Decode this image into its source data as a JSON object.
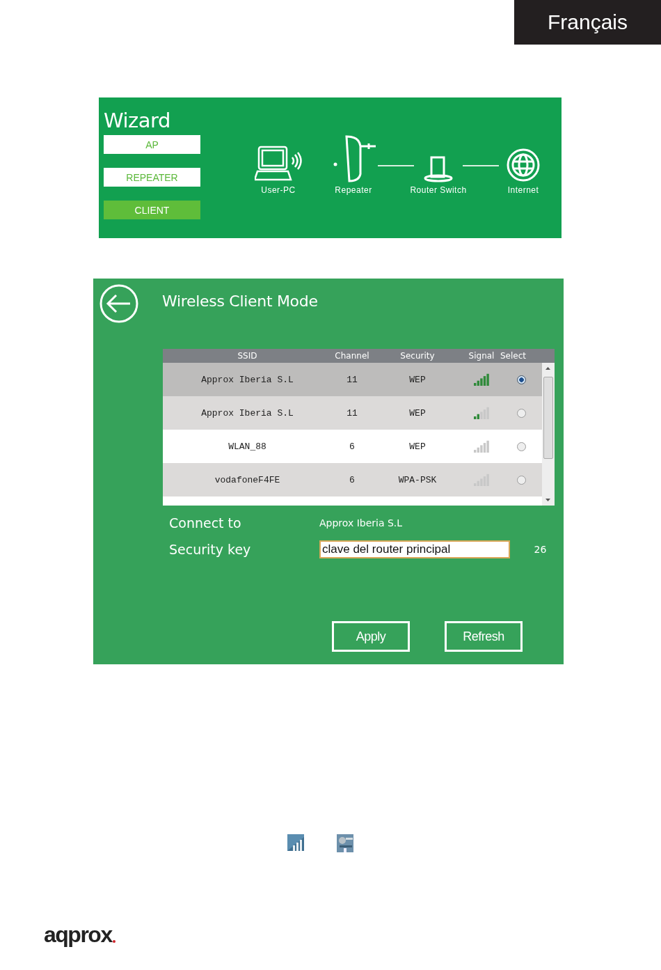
{
  "language_tab": "Français",
  "wizard": {
    "title": "Wizard",
    "modes": [
      {
        "label": "AP",
        "selected": false
      },
      {
        "label": "REPEATER",
        "selected": false
      },
      {
        "label": "CLIENT",
        "selected": true
      }
    ],
    "diagram": [
      {
        "kind": "pc",
        "label": "User-PC"
      },
      {
        "kind": "repeater",
        "label": "Repeater"
      },
      {
        "kind": "router",
        "label": "Router Switch"
      },
      {
        "kind": "internet",
        "label": "Internet"
      }
    ]
  },
  "client": {
    "title": "Wireless Client Mode",
    "columns": [
      "SSID",
      "Channel",
      "Security",
      "Signal",
      "Select"
    ],
    "rows": [
      {
        "ssid": "Approx Iberia S.L",
        "channel": "11",
        "security": "WEP",
        "kind": "strong",
        "selected": true
      },
      {
        "ssid": "Approx Iberia S.L",
        "channel": "11",
        "security": "WEP",
        "kind": "weak",
        "selected": false
      },
      {
        "ssid": "WLAN_88",
        "channel": "6",
        "security": "WEP",
        "kind": "none",
        "selected": false
      },
      {
        "ssid": "vodafoneF4FE",
        "channel": "6",
        "security": "WPA-PSK",
        "kind": "none",
        "selected": false
      }
    ],
    "connect_label": "Connect to",
    "connect_value": "Approx Iberia S.L",
    "key_label": "Security key",
    "key_value": "clave del router principal",
    "key_length": "26",
    "buttons": [
      "Apply",
      "Refresh"
    ]
  },
  "logo": "aqprox"
}
